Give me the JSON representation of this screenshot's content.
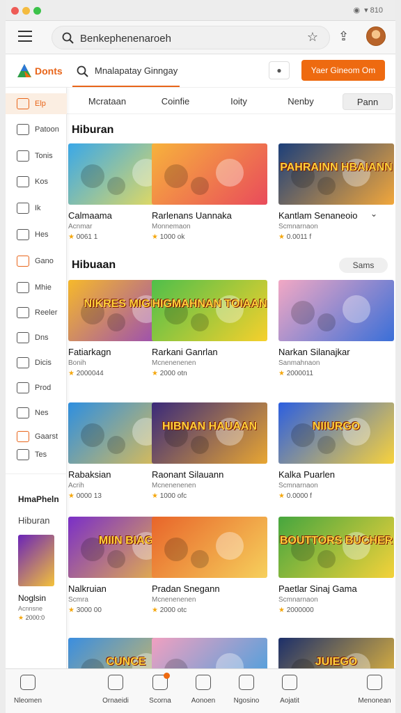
{
  "window": {
    "status_text": "▾ 810",
    "traffic_colors": [
      "#ee5b56",
      "#f4bb3f",
      "#3cc24a"
    ]
  },
  "address_bar": {
    "url": "Benkephenenaroeh"
  },
  "app": {
    "logo_text": "Donts",
    "search_text": "Mnalapatay Ginngay",
    "cta_label": "Yaer Gineom Om",
    "accent": "#ee6a10"
  },
  "sidebar": {
    "items": [
      {
        "label": "Elp",
        "icon": "grid-icon"
      },
      {
        "label": "Patoon",
        "icon": "pattern-icon"
      },
      {
        "label": "Tonis",
        "icon": "image-icon"
      },
      {
        "label": "Kos",
        "icon": "tools-icon"
      },
      {
        "label": "Ik",
        "icon": "thumbs-up-icon"
      },
      {
        "label": "Hes",
        "icon": "puzzle-icon"
      },
      {
        "label": "Gano",
        "icon": "folder-icon"
      },
      {
        "label": "Mhie",
        "icon": "card-icon"
      },
      {
        "label": "Reeler",
        "icon": "cross-icon"
      },
      {
        "label": "Dns",
        "icon": "refresh-icon"
      },
      {
        "label": "Dicis",
        "icon": "copy-icon"
      },
      {
        "label": "Prod",
        "icon": "qr-icon"
      },
      {
        "label": "Nes",
        "icon": "box-icon"
      },
      {
        "label": "Gaarst",
        "icon": "bingo-icon"
      },
      {
        "label": "Tes",
        "icon": "bolt-icon"
      }
    ],
    "section_title": "HmaPheln",
    "section_sub": "Hiburan",
    "promo_card": {
      "name": "Noglsin",
      "sub": "Acnnsne",
      "rating": "2000:0"
    }
  },
  "tabs": [
    "Mcrataan",
    "Coinfie",
    "Ioity",
    "Nenby",
    "Pann"
  ],
  "sections": [
    {
      "title": "Hiburan",
      "see_all": "",
      "cards": [
        {
          "name": "Calmaama",
          "sub": "Acnmar",
          "rating": "0061 1",
          "thumb_label": "",
          "colors": [
            "#3aa8e8",
            "#ffe24a"
          ]
        },
        {
          "name": "Rarlenans Uannaka",
          "sub": "Monnemaon",
          "rating": "1000 ok",
          "thumb_label": "",
          "colors": [
            "#f7b23c",
            "#e94b5b"
          ]
        },
        {
          "name": "Kantlam Senaneoio",
          "sub": "Scmnarnaon",
          "rating": "0.0011 f",
          "thumb_label": "PAHRAINN HBAIANN",
          "colors": [
            "#1c3f7a",
            "#f2a73b"
          ]
        }
      ]
    },
    {
      "title": "Hibuaan",
      "see_all": "Sams",
      "cards": [
        {
          "name": "Fatiarkagn",
          "sub": "Bonih",
          "rating": "2000044",
          "thumb_label": "NIKRES MIGIES",
          "colors": [
            "#f6b92b",
            "#8c3cc8"
          ]
        },
        {
          "name": "Rarkani Ganrlan",
          "sub": "Mcnenenenen",
          "rating": "2000 otn",
          "thumb_label": "HIGMAHNAN TOIAAN",
          "colors": [
            "#4fbf4a",
            "#f6d02c"
          ]
        },
        {
          "name": "Narkan Silanajkar",
          "sub": "Sanmahnaon",
          "rating": "2000011",
          "thumb_label": "",
          "colors": [
            "#f2a8c4",
            "#3a6fd8"
          ]
        }
      ]
    },
    {
      "title": "",
      "see_all": "",
      "cards": [
        {
          "name": "Rabaksian",
          "sub": "Acrih",
          "rating": "0000 13",
          "thumb_label": "",
          "colors": [
            "#2e8fe0",
            "#f6c342"
          ]
        },
        {
          "name": "Raonant Silauann",
          "sub": "Mcnenenenen",
          "rating": "1000 ofc",
          "thumb_label": "HIBNAN HAUAAN",
          "colors": [
            "#3a2a7a",
            "#e8a632"
          ]
        },
        {
          "name": "Kalka Puarlen",
          "sub": "Scmnarnaon",
          "rating": "0.0000 f",
          "thumb_label": "NIIURGO",
          "colors": [
            "#2c5fe0",
            "#f8d23c"
          ]
        }
      ]
    },
    {
      "title": "",
      "see_all": "",
      "cards": [
        {
          "name": "Nalkruian",
          "sub": "Scmra",
          "rating": "3000 00",
          "thumb_label": "MIIN BIAG",
          "colors": [
            "#7a2fc8",
            "#f4c23a"
          ]
        },
        {
          "name": "Pradan Snegann",
          "sub": "Mcnenenenen",
          "rating": "2000 otc",
          "thumb_label": "",
          "colors": [
            "#e8652a",
            "#f6d05c"
          ]
        },
        {
          "name": "Paetlar Sinaj Gama",
          "sub": "Scmnarnaon",
          "rating": "2000000",
          "thumb_label": "BOUTTORS BUCHER",
          "colors": [
            "#46a63e",
            "#f4d23a"
          ]
        }
      ]
    },
    {
      "title": "",
      "see_all": "",
      "cards": [
        {
          "name": "",
          "sub": "",
          "rating": "",
          "thumb_label": "CUNCE",
          "colors": [
            "#3a8ee0",
            "#f6c342"
          ]
        },
        {
          "name": "",
          "sub": "",
          "rating": "",
          "thumb_label": "",
          "colors": [
            "#f0a0c0",
            "#3aa0e0"
          ]
        },
        {
          "name": "",
          "sub": "",
          "rating": "",
          "thumb_label": "JUIEGO",
          "colors": [
            "#1c2f6a",
            "#f4c23a"
          ]
        }
      ]
    }
  ],
  "bottom_nav": [
    {
      "label": "Nleomen",
      "icon": "home-icon"
    },
    {
      "label": "Ornaeidi",
      "icon": "home-outline-icon"
    },
    {
      "label": "Scorna",
      "icon": "chat-icon"
    },
    {
      "label": "Aonoen",
      "icon": "grid-box-icon"
    },
    {
      "label": "Ngosino",
      "icon": "store-icon"
    },
    {
      "label": "Aojatit",
      "icon": "compass-icon"
    },
    {
      "label": "Menonean",
      "icon": "user-icon"
    }
  ]
}
